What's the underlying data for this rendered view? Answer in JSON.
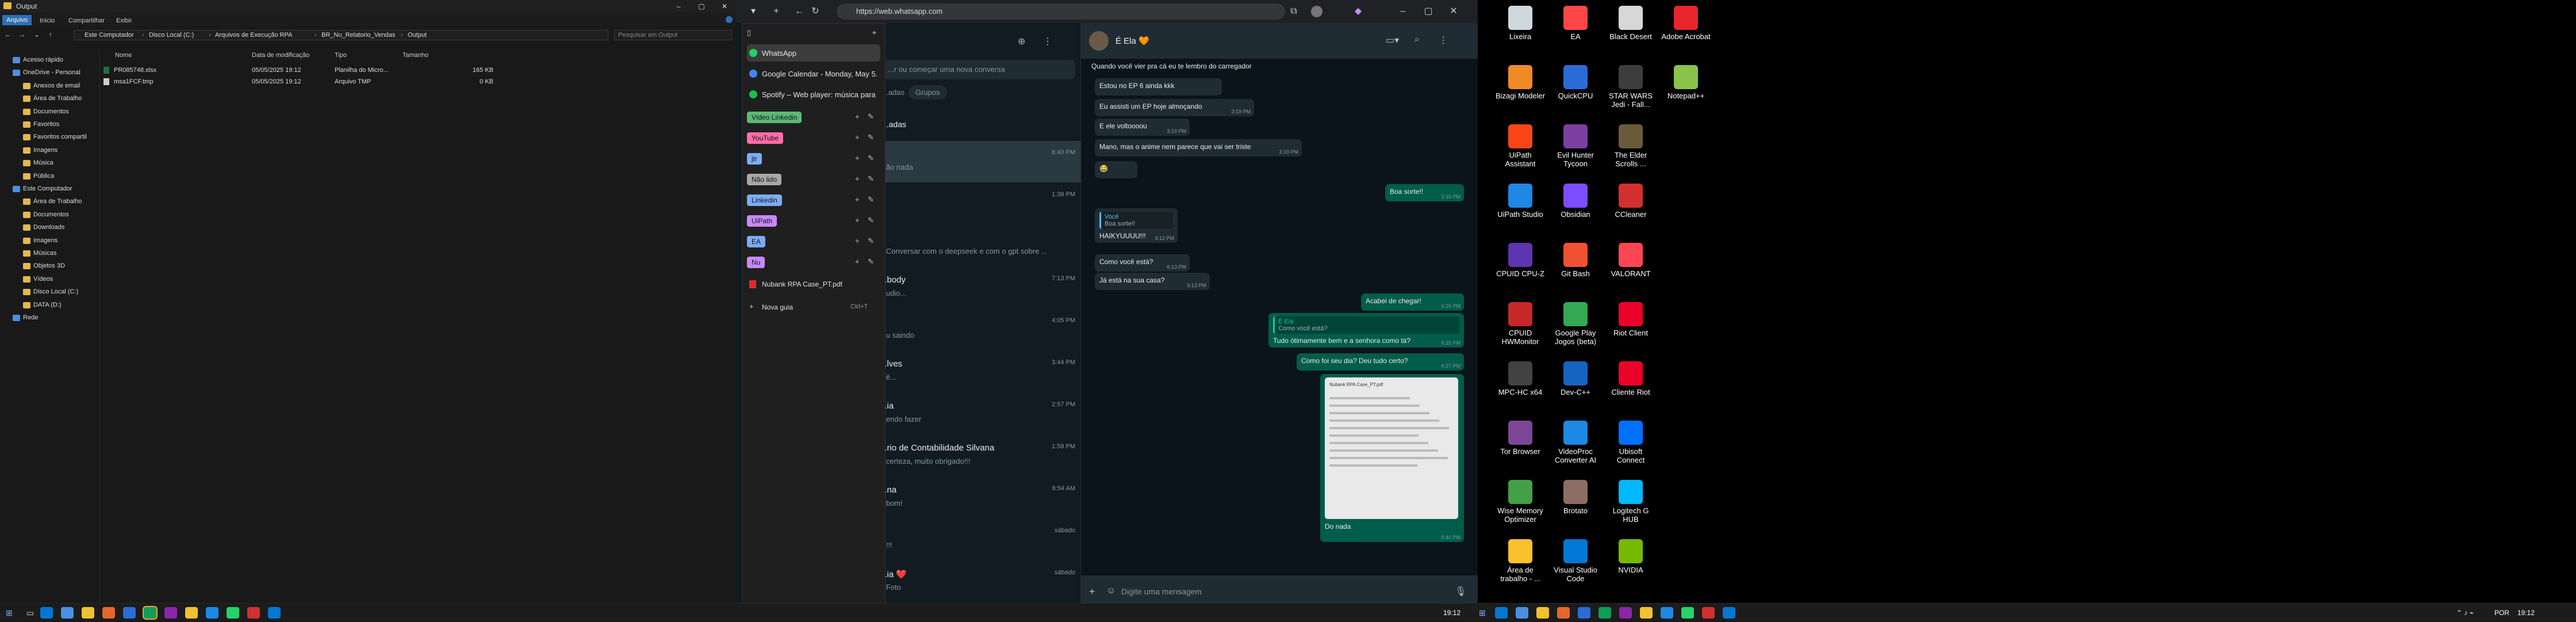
{
  "explorer": {
    "title": "Output",
    "ribbon_tabs": [
      "Arquivo",
      "Início",
      "Compartilhar",
      "Exibir"
    ],
    "breadcrumbs": [
      "Este Computador",
      "Disco Local (C:)",
      "Arquivos de Execução RPA",
      "BR_Nu_Relatorio_Vendas",
      "Output"
    ],
    "search_placeholder": "Pesquisar em Output",
    "columns": [
      "Nome",
      "Data de modificação",
      "Tipo",
      "Tamanho"
    ],
    "files": [
      {
        "name": "PR085748.xlsx",
        "modified": "05/05/2025 19:12",
        "type": "Planilha do Micro...",
        "size": "165 KB"
      },
      {
        "name": "msa1FCF.tmp",
        "modified": "05/05/2025 19:12",
        "type": "Arquivo TMP",
        "size": "0 KB"
      }
    ],
    "nav": [
      {
        "label": "Acesso rápido",
        "indent": 0
      },
      {
        "label": "OneDrive - Personal",
        "indent": 0
      },
      {
        "label": "Anexos de email",
        "indent": 1
      },
      {
        "label": "Área de Trabalho",
        "indent": 1
      },
      {
        "label": "Documentos",
        "indent": 1
      },
      {
        "label": "Favoritos",
        "indent": 1
      },
      {
        "label": "Favoritos compartil",
        "indent": 1
      },
      {
        "label": "Imagens",
        "indent": 1
      },
      {
        "label": "Música",
        "indent": 1
      },
      {
        "label": "Pública",
        "indent": 1
      },
      {
        "label": "Este Computador",
        "indent": 0
      },
      {
        "label": "Área de Trabalho",
        "indent": 1
      },
      {
        "label": "Documentos",
        "indent": 1
      },
      {
        "label": "Downloads",
        "indent": 1
      },
      {
        "label": "Imagens",
        "indent": 1
      },
      {
        "label": "Músicas",
        "indent": 1
      },
      {
        "label": "Objetos 3D",
        "indent": 1
      },
      {
        "label": "Vídeos",
        "indent": 1
      },
      {
        "label": "Disco Local (C:)",
        "indent": 1
      },
      {
        "label": "DATA (D:)",
        "indent": 1
      },
      {
        "label": "Rede",
        "indent": 0
      }
    ]
  },
  "browser": {
    "url": "https://web.whatsapp.com",
    "tab_menu": {
      "items": [
        {
          "label": "WhatsApp"
        },
        {
          "label": "Google Calendar - Monday, May 5..."
        },
        {
          "label": "Spotify – Web player: música para t..."
        }
      ],
      "groups": [
        {
          "label": "Vídeo Linkedin",
          "color": "#5bb974"
        },
        {
          "label": "YouTube",
          "color": "#ff6ea8"
        },
        {
          "label": "jtr",
          "color": "#7cacf8"
        },
        {
          "label": "Não lido",
          "color": "#a8a8a8"
        },
        {
          "label": "Linkedin",
          "color": "#7cacf8"
        },
        {
          "label": "UiPath",
          "color": "#c58af9"
        },
        {
          "label": "EA",
          "color": "#7cacf8"
        },
        {
          "label": "Nu",
          "color": "#c58af9"
        }
      ],
      "pdf_item": "Nubank RPA Case_PT.pdf",
      "new_group": "Nova guia",
      "new_group_shortcut": "Ctrl+T"
    }
  },
  "whatsapp": {
    "search_placeholder": "...r ou começar uma nova conversa",
    "filters": [
      "...adas",
      "Grupos"
    ],
    "section_label": "...adas",
    "chat_list": [
      {
        "name": "",
        "preview": "...ão nada",
        "time": "6:40 PM"
      },
      {
        "name": "",
        "preview": "",
        "time": "1:38 PM"
      },
      {
        "name": "",
        "preview": "...Conversar com o deepseek e com o gpt sobre ...",
        "time": ""
      },
      {
        "name": "...body",
        "preview": "...udio...",
        "time": "7:13 PM"
      },
      {
        "name": "",
        "preview": "...u saindo",
        "time": "4:05 PM"
      },
      {
        "name": "...lves",
        "preview": "...ê...",
        "time": "3:44 PM"
      },
      {
        "name": "...ia",
        "preview": "...endo fazer",
        "time": "2:57 PM"
      },
      {
        "name": "...rio de Contabilidade Silvana",
        "preview": "...certeza, muito obrigado!!!",
        "time": "1:58 PM"
      },
      {
        "name": "...na",
        "preview": "...bom!",
        "time": "8:54 AM"
      },
      {
        "name": "",
        "preview": "...!!!",
        "time": "sábado"
      },
      {
        "name": "...ia ❤️",
        "preview": "...Foto",
        "time": "sábado"
      }
    ],
    "contact_name": "É Ela 🧡",
    "composer_placeholder": "Digite uma mensagem",
    "messages": [
      {
        "dir": "in",
        "text": "Quando você vier pra cá eu te lembro do carregador",
        "time": ""
      },
      {
        "dir": "in",
        "text": "Estou no EP 6 ainda kkk",
        "time": ""
      },
      {
        "dir": "in",
        "text": "Eu assisti um EP hoje almoçando",
        "time": "3:19 PM"
      },
      {
        "dir": "in",
        "text": "E ele voltoooou",
        "time": "3:19 PM"
      },
      {
        "dir": "in",
        "text": "Mano, mas o anime nem parece que vai ser triste",
        "time": "3:19 PM"
      },
      {
        "dir": "in",
        "text": "😂",
        "time": ""
      },
      {
        "dir": "out",
        "text": "Boa sorte!!",
        "time": "3:39 PM"
      },
      {
        "dir": "in",
        "quote_author": "Você",
        "quote": "Boa sorte!!",
        "text": "HAIKYUUUU!!!",
        "time": "4:12 PM"
      },
      {
        "dir": "in",
        "text": "Como você está?",
        "time": "6:13 PM"
      },
      {
        "dir": "in",
        "text": "Já está na sua casa?",
        "time": "6:13 PM"
      },
      {
        "dir": "out",
        "text": "Acabei de chegar!",
        "time": "6:25 PM"
      },
      {
        "dir": "out",
        "quote_author": "É Ela",
        "quote": "Como você está?",
        "text": "Tudo ótimamente bem e a senhora como tá?",
        "time": "6:25 PM"
      },
      {
        "dir": "out",
        "text": "Como foi seu dia? Deu tudo certo?",
        "time": "6:27 PM"
      },
      {
        "dir": "out",
        "text": "Do nada",
        "time": "6:40 PM",
        "has_image": true
      }
    ],
    "image_caption": "Nubank RPA Case_PT.pdf"
  },
  "desktop_icons": [
    {
      "label": "Lixeira",
      "color": "#cfd8dc"
    },
    {
      "label": "EA",
      "color": "#ff4747"
    },
    {
      "label": "Black Desert",
      "color": "#d7d7d7"
    },
    {
      "label": "Adobe Acrobat",
      "color": "#e8262c"
    },
    {
      "label": "Bizagi Modeler",
      "color": "#f08a24"
    },
    {
      "label": "QuickCPU",
      "color": "#2a6bd8"
    },
    {
      "label": "STAR WARS Jedi - Fall...",
      "color": "#3d3d3d"
    },
    {
      "label": "Notepad++",
      "color": "#8bc34a"
    },
    {
      "label": "UiPath Assistant",
      "color": "#fa4616"
    },
    {
      "label": "Evil Hunter Tycoon",
      "color": "#7b3fa0"
    },
    {
      "label": "The Elder Scrolls ...",
      "color": "#6b5a3a"
    },
    {
      "label": "",
      "color": ""
    },
    {
      "label": "UiPath Studio",
      "color": "#1e88e5"
    },
    {
      "label": "Obsidian",
      "color": "#7c4dff"
    },
    {
      "label": "CCleaner",
      "color": "#d32f2f"
    },
    {
      "label": "",
      "color": ""
    },
    {
      "label": "CPUID CPU-Z",
      "color": "#5e35b1"
    },
    {
      "label": "Git Bash",
      "color": "#f05133"
    },
    {
      "label": "VALORANT",
      "color": "#ff4655"
    },
    {
      "label": "",
      "color": ""
    },
    {
      "label": "CPUID HWMonitor",
      "color": "#c62828"
    },
    {
      "label": "Google Play Jogos (beta)",
      "color": "#34a853"
    },
    {
      "label": "Riot Client",
      "color": "#eb0029"
    },
    {
      "label": "",
      "color": ""
    },
    {
      "label": "MPC-HC x64",
      "color": "#424242"
    },
    {
      "label": "Dev-C++",
      "color": "#1565c0"
    },
    {
      "label": "Cliente Riot",
      "color": "#eb0029"
    },
    {
      "label": "",
      "color": ""
    },
    {
      "label": "Tor Browser",
      "color": "#7d4698"
    },
    {
      "label": "VideoProc Converter AI",
      "color": "#1e88e5"
    },
    {
      "label": "Ubisoft Connect",
      "color": "#0070ff"
    },
    {
      "label": "",
      "color": ""
    },
    {
      "label": "Wise Memory Optimizer",
      "color": "#43a047"
    },
    {
      "label": "Brotato",
      "color": "#8d6e63"
    },
    {
      "label": "Logitech G HUB",
      "color": "#00b8fc"
    },
    {
      "label": "",
      "color": ""
    },
    {
      "label": "Área de trabalho - ...",
      "color": "#fbc02d"
    },
    {
      "label": "Visual Studio Code",
      "color": "#0078d4"
    },
    {
      "label": "NVIDIA",
      "color": "#76b900"
    }
  ],
  "taskbar": {
    "time_left": "19:12",
    "lang": "POR",
    "time_right": "19:12",
    "apps": [
      "#0078d4",
      "#4a90e2",
      "#f2c12e",
      "#e6662e",
      "#2a6bd8",
      "#0f9d58",
      "#8e24aa",
      "#f2c12e",
      "#1e88e5",
      "#25d366",
      "#d32f2f",
      "#0078d4"
    ]
  }
}
